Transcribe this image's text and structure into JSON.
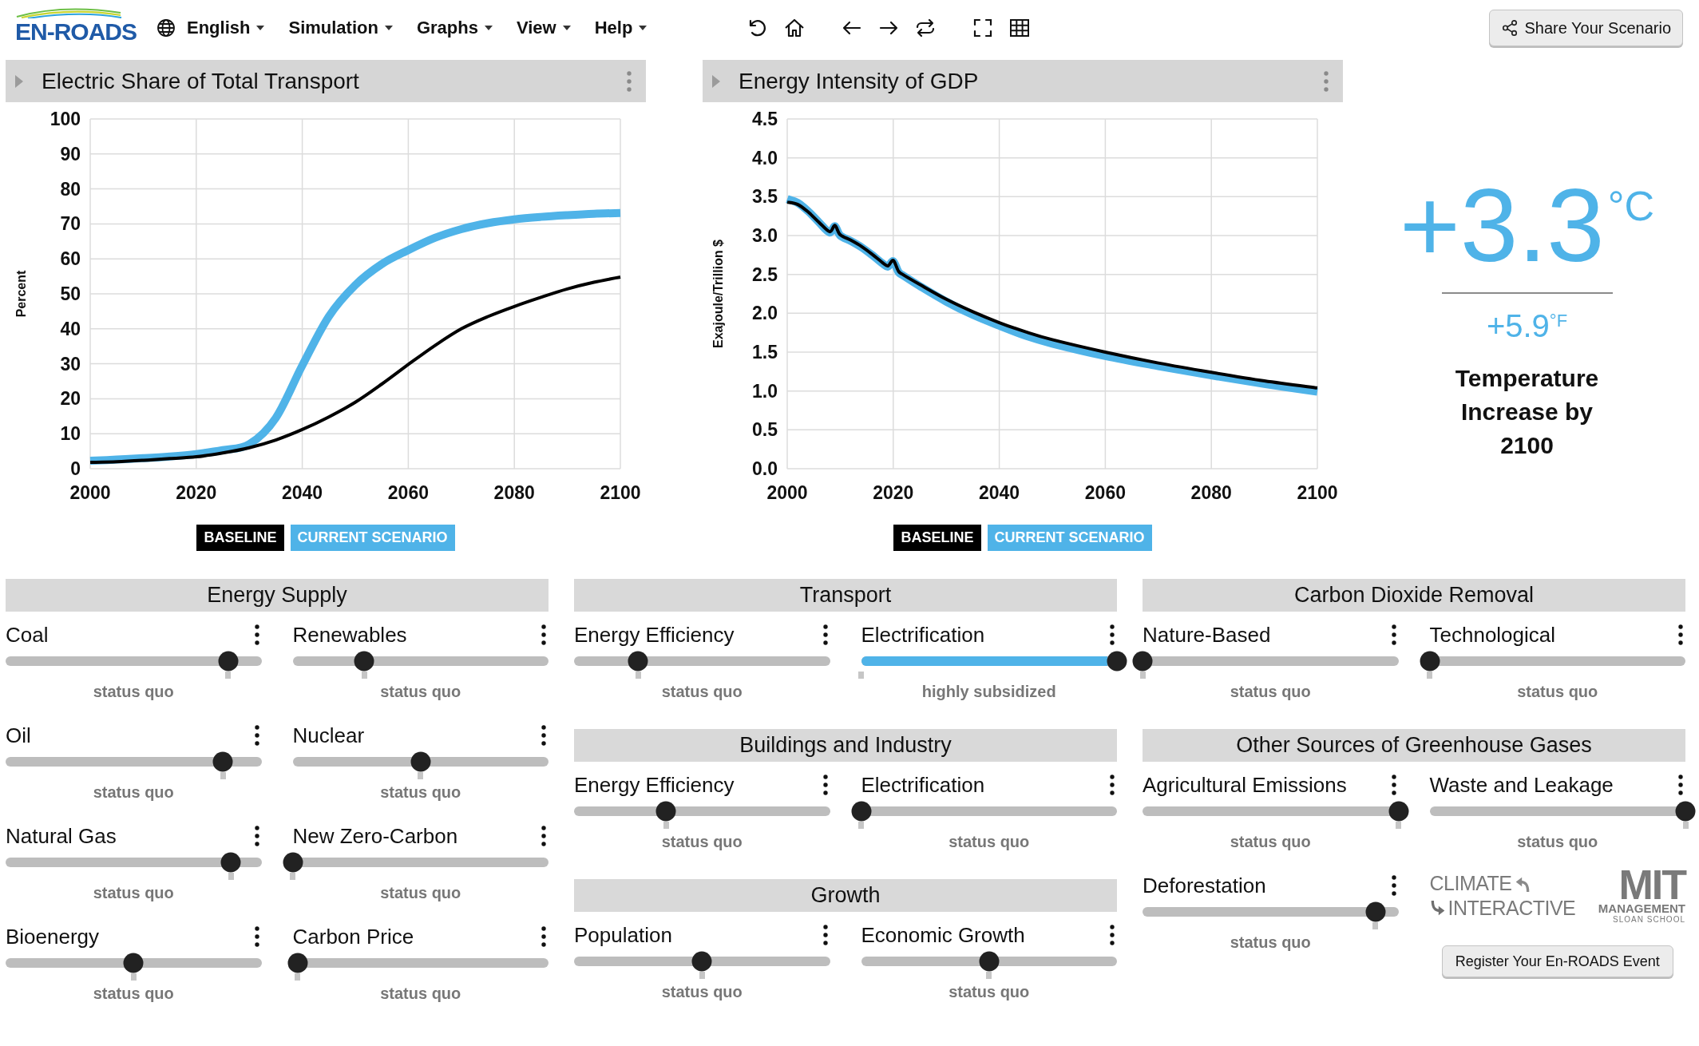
{
  "header": {
    "logo": "EN-ROADS",
    "menus": [
      {
        "label": "English",
        "kind": "language"
      },
      {
        "label": "Simulation",
        "kind": "dropdown"
      },
      {
        "label": "Graphs",
        "kind": "dropdown"
      },
      {
        "label": "View",
        "kind": "dropdown"
      },
      {
        "label": "Help",
        "kind": "dropdown"
      }
    ],
    "share_button": "Share Your Scenario"
  },
  "graphs": [
    {
      "title": "Electric Share of Total Transport",
      "chart_data": {
        "type": "line",
        "ylabel": "Percent",
        "x": [
          2000,
          2005,
          2010,
          2015,
          2020,
          2025,
          2030,
          2035,
          2040,
          2045,
          2050,
          2055,
          2060,
          2065,
          2070,
          2075,
          2080,
          2085,
          2090,
          2095,
          2100
        ],
        "xlim": [
          2000,
          2100
        ],
        "ylim": [
          0,
          100
        ],
        "xticks": [
          2000,
          2020,
          2040,
          2060,
          2080,
          2100
        ],
        "yticks": [
          0,
          10,
          20,
          30,
          40,
          50,
          60,
          70,
          80,
          90,
          100
        ],
        "grid": true,
        "series": [
          {
            "name": "BASELINE",
            "color": "#000000",
            "values": [
              1.8,
              2.0,
              2.4,
              2.9,
              3.4,
              4.5,
              6.0,
              8.2,
              11.2,
              14.8,
              19.0,
              24.2,
              29.8,
              35.2,
              40.0,
              43.5,
              46.4,
              49.0,
              51.4,
              53.3,
              54.8
            ]
          },
          {
            "name": "CURRENT SCENARIO",
            "color": "#4fb3e8",
            "values": [
              2.3,
              2.6,
              3.0,
              3.5,
              4.2,
              5.3,
              7.0,
              14.5,
              29.5,
              43.5,
              52.5,
              58.5,
              62.5,
              66.0,
              68.5,
              70.2,
              71.3,
              72.0,
              72.5,
              72.9,
              73.1
            ]
          }
        ]
      }
    },
    {
      "title": "Energy Intensity of GDP",
      "chart_data": {
        "type": "line",
        "ylabel": "Exajoule/Trillion $",
        "x": [
          2000,
          2002,
          2004,
          2006,
          2008,
          2009,
          2010,
          2012,
          2014,
          2016,
          2018,
          2019,
          2020,
          2021,
          2022,
          2025,
          2030,
          2035,
          2040,
          2045,
          2050,
          2060,
          2070,
          2080,
          2090,
          2100
        ],
        "xlim": [
          2000,
          2100
        ],
        "ylim": [
          0,
          4.5
        ],
        "xticks": [
          2000,
          2020,
          2040,
          2060,
          2080,
          2100
        ],
        "yticks": [
          {
            "value": 0,
            "label": "0.0"
          },
          0.5,
          {
            "value": 1,
            "label": "1.0"
          },
          1.5,
          {
            "value": 2,
            "label": "2.0"
          },
          2.5,
          {
            "value": 3,
            "label": "3.0"
          },
          3.5,
          {
            "value": 4,
            "label": "4.0"
          },
          4.5
        ],
        "grid": true,
        "series": [
          {
            "name": "BASELINE",
            "color": "#000000",
            "values": [
              3.43,
              3.4,
              3.3,
              3.17,
              3.05,
              3.13,
              3.01,
              2.94,
              2.86,
              2.76,
              2.65,
              2.61,
              2.68,
              2.54,
              2.49,
              2.37,
              2.18,
              2.02,
              1.88,
              1.76,
              1.66,
              1.5,
              1.36,
              1.24,
              1.13,
              1.04
            ]
          },
          {
            "name": "CURRENT SCENARIO",
            "color": "#4fb3e8",
            "values": [
              3.47,
              3.42,
              3.31,
              3.17,
              3.04,
              3.12,
              3.0,
              2.93,
              2.85,
              2.75,
              2.64,
              2.6,
              2.67,
              2.53,
              2.48,
              2.35,
              2.15,
              1.98,
              1.84,
              1.71,
              1.61,
              1.45,
              1.32,
              1.2,
              1.09,
              0.99
            ]
          }
        ]
      }
    }
  ],
  "temperature": {
    "celsius": "+3.3$^{°C}$",
    "fahrenheit": "+5.9$^{°F}$",
    "caption": "Temperature Increase by 2100"
  },
  "columns": [
    {
      "sections": [
        {
          "title": "Energy Supply",
          "sliders": [
            {
              "label": "Coal",
              "level": 0.87,
              "default": {
                "level": 0.87
              },
              "setting": "status quo"
            },
            {
              "label": "Renewables",
              "level": 0.28,
              "default": {
                "level": 0.28
              },
              "setting": "status quo"
            },
            {
              "label": "Oil",
              "level": 0.85,
              "default": {
                "level": 0.85
              },
              "setting": "status quo"
            },
            {
              "label": "Nuclear",
              "level": 0.5,
              "default": {
                "level": 0.5
              },
              "setting": "status quo"
            },
            {
              "label": "Natural Gas",
              "level": 0.88,
              "default": {
                "level": 0.88
              },
              "setting": "status quo"
            },
            {
              "label": "New Zero-Carbon",
              "level": 0,
              "default": {
                "level": 0
              },
              "setting": "status quo"
            },
            {
              "label": "Bioenergy",
              "level": 0.5,
              "default": {
                "level": 0.5
              },
              "setting": "status quo"
            },
            {
              "label": "Carbon Price",
              "level": 0.02,
              "default": {
                "level": 0.02
              },
              "setting": "status quo"
            }
          ]
        }
      ]
    },
    {
      "sections": [
        {
          "title": "Transport",
          "sliders": [
            {
              "label": "Energy Efficiency",
              "level": 0.25,
              "default": {
                "level": 0.25
              },
              "setting": "status quo"
            },
            {
              "label": "Electrification",
              "level": 1,
              "default": {
                "level": 0
              },
              "setting": "highly subsidized"
            }
          ]
        },
        {
          "title": "Buildings and Industry",
          "sliders": [
            {
              "label": "Energy Efficiency",
              "level": 0.36,
              "default": {
                "level": 0.36
              },
              "setting": "status quo"
            },
            {
              "label": "Electrification",
              "level": 0,
              "default": {
                "level": 0
              },
              "setting": "status quo"
            }
          ]
        },
        {
          "title": "Growth",
          "sliders": [
            {
              "label": "Population",
              "level": 0.5,
              "default": {
                "level": 0.5
              },
              "setting": "status quo"
            },
            {
              "label": "Economic Growth",
              "level": 0.5,
              "default": {
                "level": 0.5
              },
              "setting": "status quo"
            }
          ]
        }
      ]
    },
    {
      "sections": [
        {
          "title": "Carbon Dioxide Removal",
          "sliders": [
            {
              "label": "Nature-Based",
              "level": 0,
              "default": {
                "level": 0
              },
              "setting": "status quo"
            },
            {
              "label": "Technological",
              "level": 0,
              "default": {
                "level": 0
              },
              "setting": "status quo"
            }
          ]
        },
        {
          "title": "Other Sources of Greenhouse Gases",
          "sliders": [
            {
              "label": "Agricultural Emissions",
              "level": 1,
              "default": {
                "level": 1
              },
              "setting": "status quo"
            },
            {
              "label": "Waste and Leakage",
              "level": 1,
              "default": {
                "level": 1
              },
              "setting": "status quo"
            },
            {
              "label": "Deforestation",
              "level": 0.91,
              "default": {
                "level": 0.91
              },
              "setting": "status quo"
            }
          ]
        }
      ],
      "footer": {
        "partners": [
          {
            "kind": "climate",
            "lines": [
              "CLIMATE",
              "INTERACTIVE"
            ]
          },
          {
            "kind": "mit",
            "lines": [
              "MIT",
              "MANAGEMENT",
              "SLOAN SCHOOL"
            ]
          }
        ],
        "register_button": "Register Your En-ROADS Event"
      }
    }
  ]
}
